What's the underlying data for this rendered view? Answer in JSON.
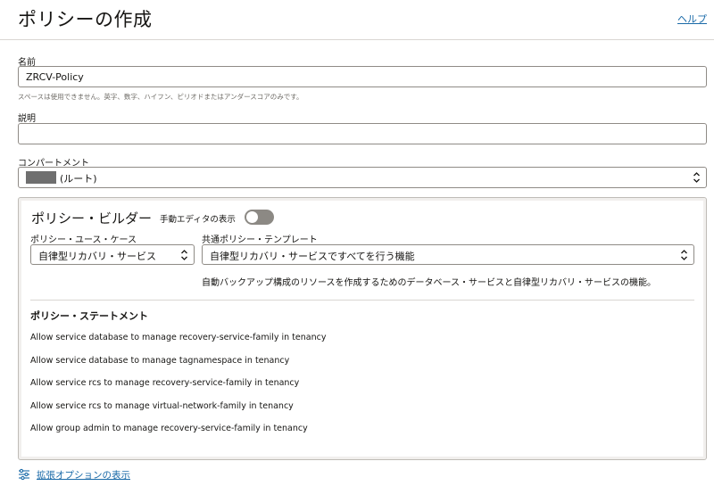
{
  "header": {
    "title": "ポリシーの作成",
    "help_label": "ヘルプ"
  },
  "form": {
    "name": {
      "label": "名前",
      "value": "ZRCV-Policy",
      "hint": "スペースは使用できません。英字、数字、ハイフン、ピリオドまたはアンダースコアのみです。"
    },
    "description": {
      "label": "説明",
      "value": ""
    },
    "compartment": {
      "label": "コンパートメント",
      "value": "(ルート)"
    }
  },
  "builder": {
    "title": "ポリシー・ビルダー",
    "manual_editor_label": "手動エディタの表示",
    "manual_editor_on": false,
    "use_case": {
      "label": "ポリシー・ユース・ケース",
      "value": "自律型リカバリ・サービス"
    },
    "template": {
      "label": "共通ポリシー・テンプレート",
      "value": "自律型リカバリ・サービスですべてを行う機能"
    },
    "template_description": "自動バックアップ構成のリソースを作成するためのデータベース・サービスと自律型リカバリ・サービスの機能。",
    "statements_title": "ポリシー・ステートメント",
    "statements": [
      "Allow service database to manage recovery-service-family in tenancy",
      "Allow service database to manage tagnamespace in tenancy",
      "Allow service rcs to manage recovery-service-family in tenancy",
      "Allow service rcs to manage virtual-network-family in tenancy",
      "Allow group admin to manage recovery-service-family in tenancy"
    ]
  },
  "advanced_options_label": "拡張オプションの表示",
  "colors": {
    "link": "#1a6aa8",
    "toggle_off": "#8c8984",
    "redaction": "#6f6f6f"
  }
}
